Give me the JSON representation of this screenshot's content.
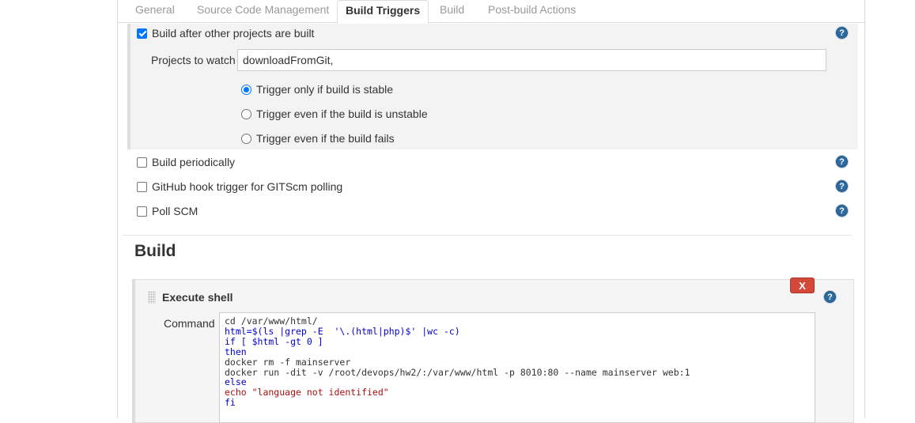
{
  "tabs": [
    {
      "label": "General",
      "active": false
    },
    {
      "label": "Source Code Management",
      "active": false
    },
    {
      "label": "Build Triggers",
      "active": true
    },
    {
      "label": "Build",
      "active": false
    },
    {
      "label": "Post-build Actions",
      "active": false
    }
  ],
  "triggers": {
    "build_after": {
      "label": "Build after other projects are built",
      "checked": true
    },
    "projects_to_watch": {
      "label": "Projects to watch",
      "value": "downloadFromGit,"
    },
    "radio_options": [
      {
        "label": "Trigger only if build is stable",
        "selected": true
      },
      {
        "label": "Trigger even if the build is unstable",
        "selected": false
      },
      {
        "label": "Trigger even if the build fails",
        "selected": false
      }
    ],
    "build_periodically": {
      "label": "Build periodically",
      "checked": false
    },
    "github_hook": {
      "label": "GitHub hook trigger for GITScm polling",
      "checked": false
    },
    "poll_scm": {
      "label": "Poll SCM",
      "checked": false
    }
  },
  "build": {
    "title": "Build",
    "execute_shell": {
      "title": "Execute shell",
      "delete_label": "X",
      "command_label": "Command",
      "command_lines": [
        "cd /var/www/html/",
        "html=$(ls |grep -E  '\\.(html|php)$' |wc -c)",
        "if [ $html -gt 0 ]",
        "then",
        "docker rm -f mainserver",
        "docker run -dit -v /root/devops/hw2/:/var/www/html -p 8010:80 --name mainserver web:1",
        "else",
        "echo \"language not identified\"",
        "fi"
      ]
    }
  },
  "help_label": "?",
  "colors": {
    "accent": "#0075ff",
    "help": "#2d6a9f",
    "delete": "#d24939"
  }
}
